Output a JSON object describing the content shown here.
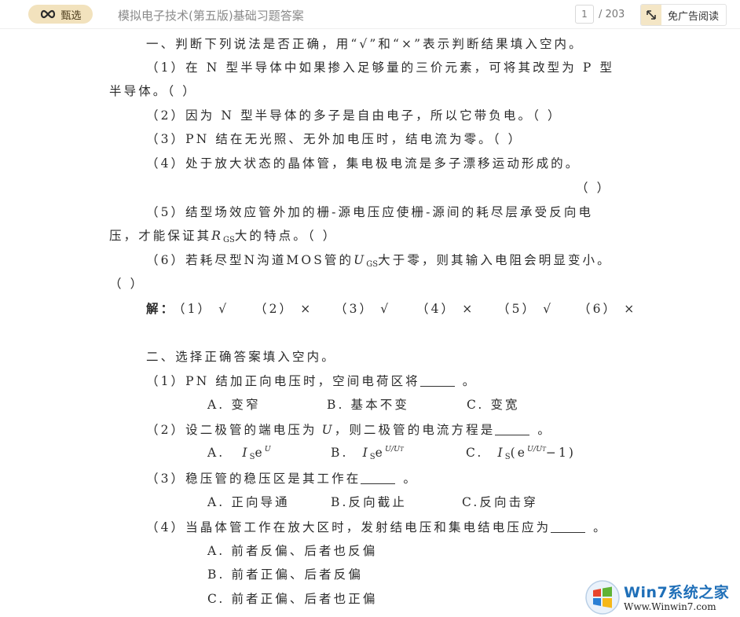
{
  "toolbar": {
    "badge_label": "甄选",
    "doc_title": "模拟电子技术(第五版)基础习题答案",
    "page_current": "1",
    "page_total": "/ 203",
    "adfree_label": "免广告阅读"
  },
  "section1": {
    "heading": "一、判断下列说法是否正确，用“√”和“×”表示判断结果填入空内。",
    "q1a": "（1）在 N 型半导体中如果掺入足够量的三价元素，可将其改型为 P 型",
    "q1b": "半导体。（    ）",
    "q2": "（2）因为 N 型半导体的多子是自由电子，所以它带负电。（    ）",
    "q3": "（3）PN 结在无光照、无外加电压时，结电流为零。（    ）",
    "q4a": "（4）处于放大状态的晶体管，集电极电流是多子漂移运动形成的。",
    "q4b": "（    ）",
    "q5a": "（5）结型场效应管外加的栅-源电压应使栅-源间的耗尽层承受反向电",
    "q5b_pre": "压，才能保证其",
    "q5b_sym": "R",
    "q5b_sub": "GS",
    "q5b_post": "大的特点。（    ）",
    "q6_pre": "（6）若耗尽型N沟道MOS管的",
    "q6_sym": "U",
    "q6_sub": "GS",
    "q6_post": "大于零，则其输入电阻会明显变小。",
    "q6b": "（    ）",
    "ans_label": "解：",
    "answers": [
      "（1） √",
      "（2） ×",
      "（3） √",
      "（4） ×",
      "（5） √",
      "（6） ×"
    ]
  },
  "section2": {
    "heading": "二、选择正确答案填入空内。",
    "q1": "（1）PN 结加正向电压时，空间电荷区将",
    "q1_end": "。",
    "q1_opts": [
      "A. 变窄",
      "B. 基本不变",
      "C. 变宽"
    ],
    "q2_pre": "（2）设二极管的端电压为",
    "q2_sym": "U",
    "q2_post": "，则二极管的电流方程是",
    "q2_end": "。",
    "q2_opt_labels": [
      "A.",
      "B.",
      "C."
    ],
    "q2_I": "I",
    "q2_S": "S",
    "q2_e": "e",
    "q2_expA": "U",
    "q2_expB": "U/U",
    "q2_T": "T",
    "q2_optC_paren": "(e",
    "q2_optC_tail": "−1)",
    "q3": "（3）稳压管的稳压区是其工作在",
    "q3_end": "。",
    "q3_opts": [
      "A. 正向导通",
      "B.反向截止",
      "C.反向击穿"
    ],
    "q4": "（4）当晶体管工作在放大区时，发射结电压和集电结电压应为",
    "q4_end": "。",
    "q4_opts": [
      "A. 前者反偏、后者也反偏",
      "B. 前者正偏、后者反偏",
      "C. 前者正偏、后者也正偏"
    ]
  },
  "watermark": {
    "text": "Win7系统之家",
    "url": "Www.Winwin7.com"
  }
}
